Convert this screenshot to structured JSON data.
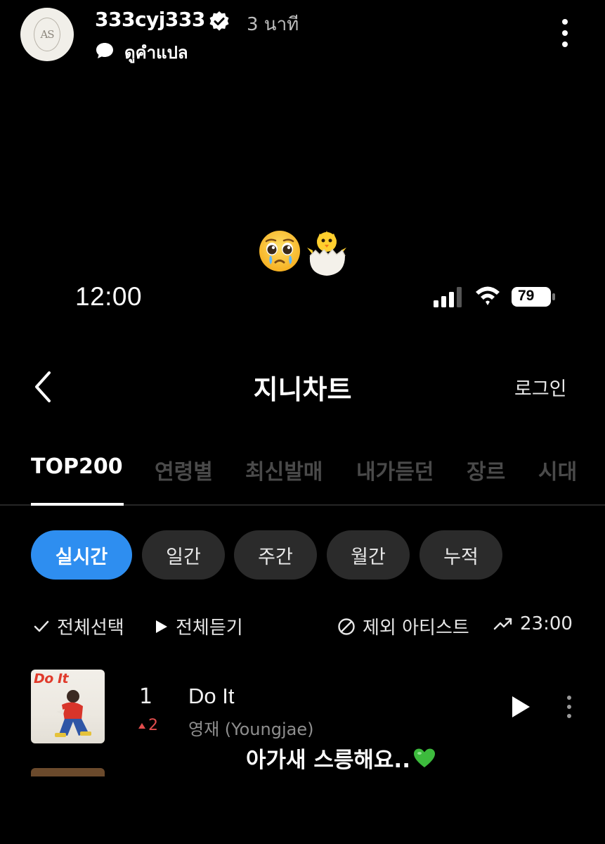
{
  "story": {
    "username": "333cyj333",
    "time_ago": "3 นาที",
    "translate_label": "ดูคำแปล",
    "avatar_text": "AS"
  },
  "overlay": {
    "emojis": [
      "pleading-face-emoji",
      "hatching-chick-emoji"
    ],
    "caption": "아가새 스릉해요..",
    "caption_emoji": "green-heart-emoji"
  },
  "status_bar": {
    "time": "12:00",
    "battery": "79"
  },
  "app": {
    "title": "지니차트",
    "login_label": "로그인",
    "tabs": [
      {
        "label": "TOP200",
        "active": true
      },
      {
        "label": "연령별",
        "active": false
      },
      {
        "label": "최신발매",
        "active": false
      },
      {
        "label": "내가듣던",
        "active": false
      },
      {
        "label": "장르",
        "active": false
      },
      {
        "label": "시대",
        "active": false
      }
    ],
    "periods": [
      {
        "label": "실시간",
        "active": true
      },
      {
        "label": "일간",
        "active": false
      },
      {
        "label": "주간",
        "active": false
      },
      {
        "label": "월간",
        "active": false
      },
      {
        "label": "누적",
        "active": false
      }
    ],
    "actions": {
      "select_all": "전체선택",
      "play_all": "전체듣기",
      "exclude_artist": "제외 아티스트",
      "chart_time": "23:00"
    },
    "chart": [
      {
        "rank": "1",
        "change": "2",
        "change_direction": "up",
        "title": "Do It",
        "artist": "영재 (Youngjae)",
        "album_text": "Do It"
      }
    ]
  },
  "colors": {
    "accent": "#2e8ef0",
    "rank_up": "#e24d4d",
    "background": "#000000"
  }
}
